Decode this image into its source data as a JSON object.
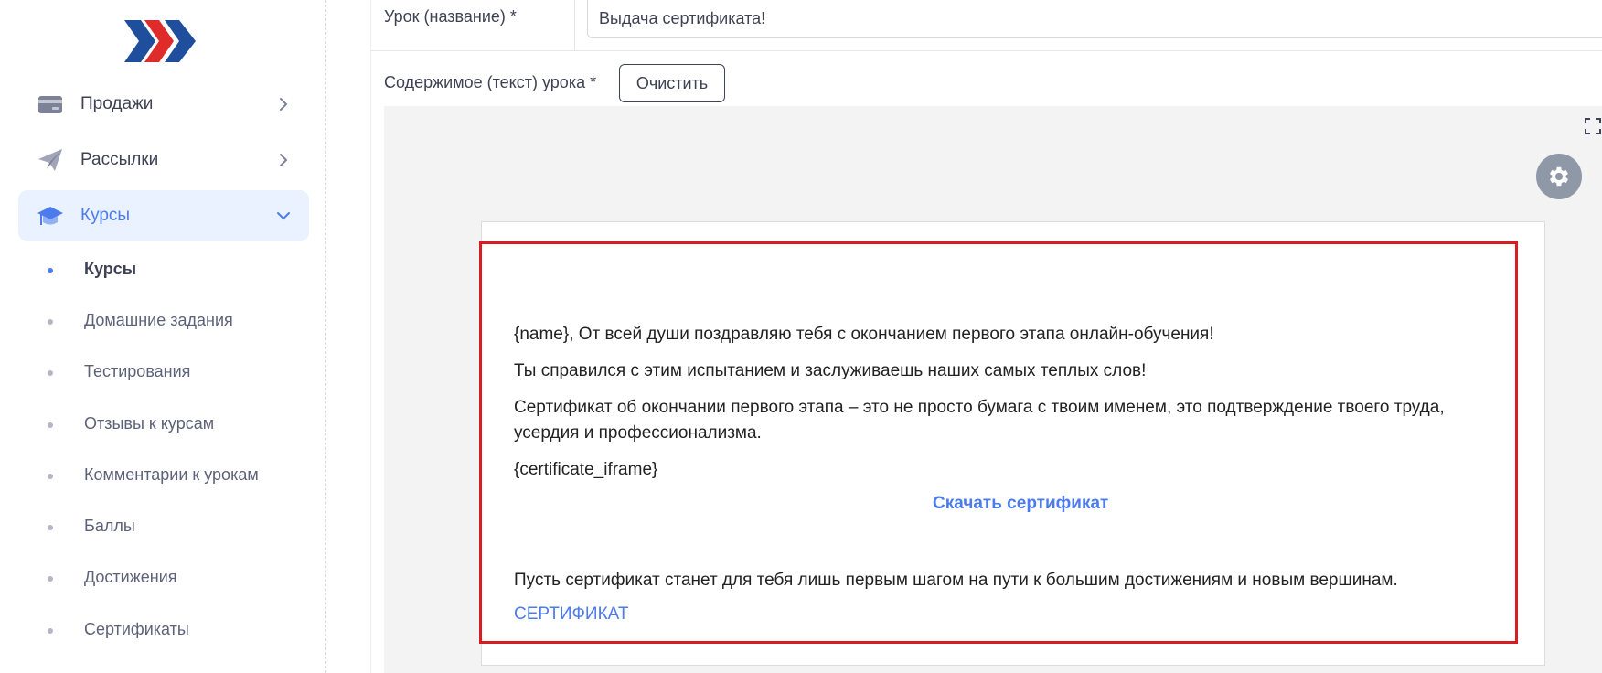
{
  "sidebar": {
    "menu": [
      {
        "label": "Продажи",
        "icon": "credit-card-icon"
      },
      {
        "label": "Рассылки",
        "icon": "paper-plane-icon"
      },
      {
        "label": "Курсы",
        "icon": "graduation-cap-icon"
      }
    ],
    "submenu": [
      "Курсы",
      "Домашние задания",
      "Тестирования",
      "Отзывы к курсам",
      "Комментарии к урокам",
      "Баллы",
      "Достижения",
      "Сертификаты"
    ]
  },
  "form": {
    "lesson_label": "Урок (название) *",
    "lesson_value": "Выдача сертификата!",
    "content_label": "Содержимое (текст) урока *",
    "clear_button": "Очистить"
  },
  "document": {
    "p1": "{name}, От всей души поздравляю тебя с окончанием первого этапа онлайн-обучения!",
    "p2": "Ты справился с этим испытанием и заслуживаешь наших самых теплых слов!",
    "p3_line1": "Сертификат об окончании первого этапа – это не просто бумага с твоим именем, это подтверждение твоего труда,",
    "p3_line2": "усердия и профессионализма.",
    "p4": "{certificate_iframe}",
    "download_link": "Скачать сертификат",
    "p5": "Пусть сертификат станет для тебя лишь первым шагом на пути к большим достижениям и новым вершинам.",
    "cert_link": "СЕРТИФИКАТ"
  },
  "colors": {
    "accent": "#4b7bec",
    "highlight": "#d91c24",
    "logo_blue": "#1f4e9c",
    "logo_red": "#e02b2b"
  }
}
